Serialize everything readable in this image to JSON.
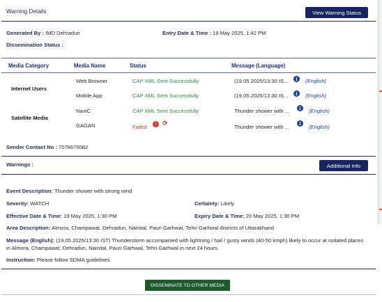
{
  "header": {
    "title": "Warning Details",
    "view_status_button": "View Warning Status"
  },
  "meta": {
    "generated_by_label": "Generated By :",
    "generated_by_value": "IMD Dehradun",
    "entry_datetime_label": "Entry Date & Time :",
    "entry_datetime_value": "19 May 2025, 1:42 PM",
    "dissemination_status_label": "Dissemination Status :"
  },
  "table": {
    "columns": [
      "Media Category",
      "Media Name",
      "Status",
      "Message (Language)"
    ],
    "groups": [
      {
        "category": "Internet Users",
        "rows": [
          {
            "media_name": "Web Browser",
            "status": "CAP XML Sent Successfully",
            "status_type": "success",
            "message": "(19.05.2025/13:30 IS...",
            "language": "(English)"
          },
          {
            "media_name": "Mobile App",
            "status": "CAP XML Sent Successfully",
            "status_type": "success",
            "message": "(19.05.2025/13:30 IS...",
            "language": "(English)"
          }
        ]
      },
      {
        "category": "Satellite Media",
        "rows": [
          {
            "media_name": "NavIC",
            "status": "CAP XML Sent Successfully",
            "status_type": "success",
            "message": "Thunder shower with ...",
            "language": "(English)"
          },
          {
            "media_name": "GAGAN",
            "status": "Failed",
            "status_type": "failed",
            "message": "Thunder shower with ...",
            "language": "(English)"
          }
        ]
      }
    ]
  },
  "sender": {
    "label": "Sender Contact No :",
    "value": "7078675082"
  },
  "warnings": {
    "title": "Warnings :",
    "additional_info_button": "Additional Info"
  },
  "details": {
    "event_description_label": "Event Description:",
    "event_description_value": "Thunder shower with strong wind",
    "severity_label": "Severity:",
    "severity_value": "WATCH",
    "certainty_label": "Certainty:",
    "certainty_value": "Likely",
    "effective_label": "Effective Date & Time:",
    "effective_value": "19 May 2025, 1:30 PM",
    "expiry_label": "Expiry Date & Time:",
    "expiry_value": "20 May 2025, 1:30 PM",
    "area_label": "Area Description:",
    "area_value": "Almora, Champawat, Dehradun, Nainital, Pauri Garhwal, Tehri Garhwal districts of Uttarakhand",
    "message_label": "Message (English):",
    "message_value": "(19.05.2025/13:30 IST) Thunderstorm accompanied with lightning / hail / gusty winds (40-50 kmph) likely to occur at isolated places in Almora, Champawat, Dehradun, Nainital, Pauri Garhwal, Tehri Garhwal in next 24 hours.",
    "instruction_label": "Instruction:",
    "instruction_value": "Please follow SDMA guidelines."
  },
  "footer": {
    "disseminate_button": "DISSEMINATE TO OTHER MEDIA"
  },
  "icons": {
    "info": "info-icon",
    "error": "error-icon",
    "retry": "retry-icon"
  },
  "colors": {
    "navy": "#16255f",
    "success": "#2e8a3a",
    "failed": "#d8362a",
    "disseminate": "#1d5a2c"
  }
}
